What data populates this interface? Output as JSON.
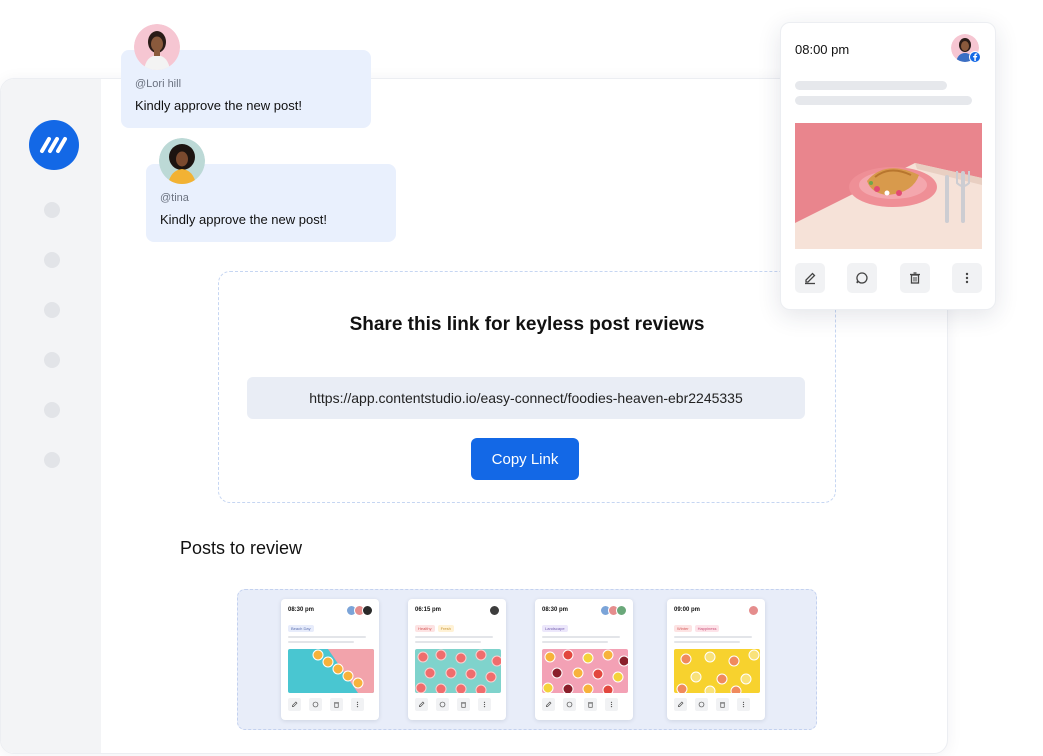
{
  "comments": [
    {
      "handle": "@Lori hill",
      "message": "Kindly approve the new post!"
    },
    {
      "handle": "@tina",
      "message": "Kindly approve the new post!"
    }
  ],
  "share": {
    "title": "Share this link for keyless post reviews",
    "link": "https://app.contentstudio.io/easy-connect/foodies-heaven-ebr2245335",
    "copy_label": "Copy Link"
  },
  "posts_to_review": {
    "title": "Posts to review",
    "cards": [
      {
        "time": "08:30 pm",
        "tags": [
          "Beach Day"
        ],
        "image": "orange-slices-teal-pink"
      },
      {
        "time": "06:15 pm",
        "tags": [
          "Healthy",
          "Fresh"
        ],
        "image": "grapefruit-teal"
      },
      {
        "time": "08:30 pm",
        "tags": [
          "Landscape"
        ],
        "image": "citrus-pink"
      },
      {
        "time": "09:00 pm",
        "tags": [
          "Winter",
          "Happiness"
        ],
        "image": "lemons-yellow"
      }
    ]
  },
  "post_preview": {
    "time": "08:00 pm",
    "image": "croissant-on-plate",
    "actions": [
      "edit-icon",
      "comment-icon",
      "trash-icon",
      "more-icon"
    ]
  },
  "colors": {
    "brand": "#1368e6",
    "bubble": "#e9f0fd",
    "sidebar": "#f3f4f6"
  }
}
